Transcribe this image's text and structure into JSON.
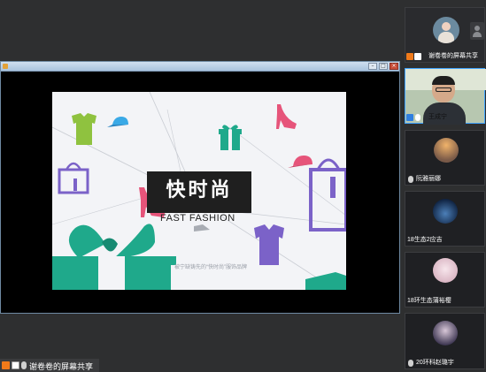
{
  "shared_screen": {
    "slide": {
      "title_cn": "快时尚",
      "title_en": "FAST FASHION",
      "footer": "被宁缺铸先的“快时尚”服饰品牌"
    }
  },
  "share_label": "谢卷卷的屏幕共享",
  "participants": [
    {
      "name": "谢卷卷的屏幕共享",
      "role": "host",
      "active": false
    },
    {
      "name": "王成宁",
      "role": "member",
      "active": true
    },
    {
      "name": "阮雅丽娜",
      "role": "member",
      "active": false
    },
    {
      "name": "18生态2应吉",
      "role": "member",
      "active": false
    },
    {
      "name": "18环生态蒲裕樱",
      "role": "member",
      "active": false
    },
    {
      "name": "20环科赵璐宇",
      "role": "member",
      "active": false
    }
  ],
  "icons": {
    "window_app": "app-icon",
    "minimize": "minimize-icon",
    "maximize": "maximize-icon",
    "close": "close-icon",
    "host_badge": "host-icon",
    "screen_share": "screen-share-icon",
    "mic": "mic-icon",
    "person": "person-icon"
  },
  "colors": {
    "active_border": "#3fa3ff",
    "host_orange": "#f07a1a",
    "member_blue": "#2f7fe0",
    "teal": "#1fa98b",
    "pink": "#e6547a",
    "purple": "#7b62c8",
    "green": "#8fc23f"
  }
}
